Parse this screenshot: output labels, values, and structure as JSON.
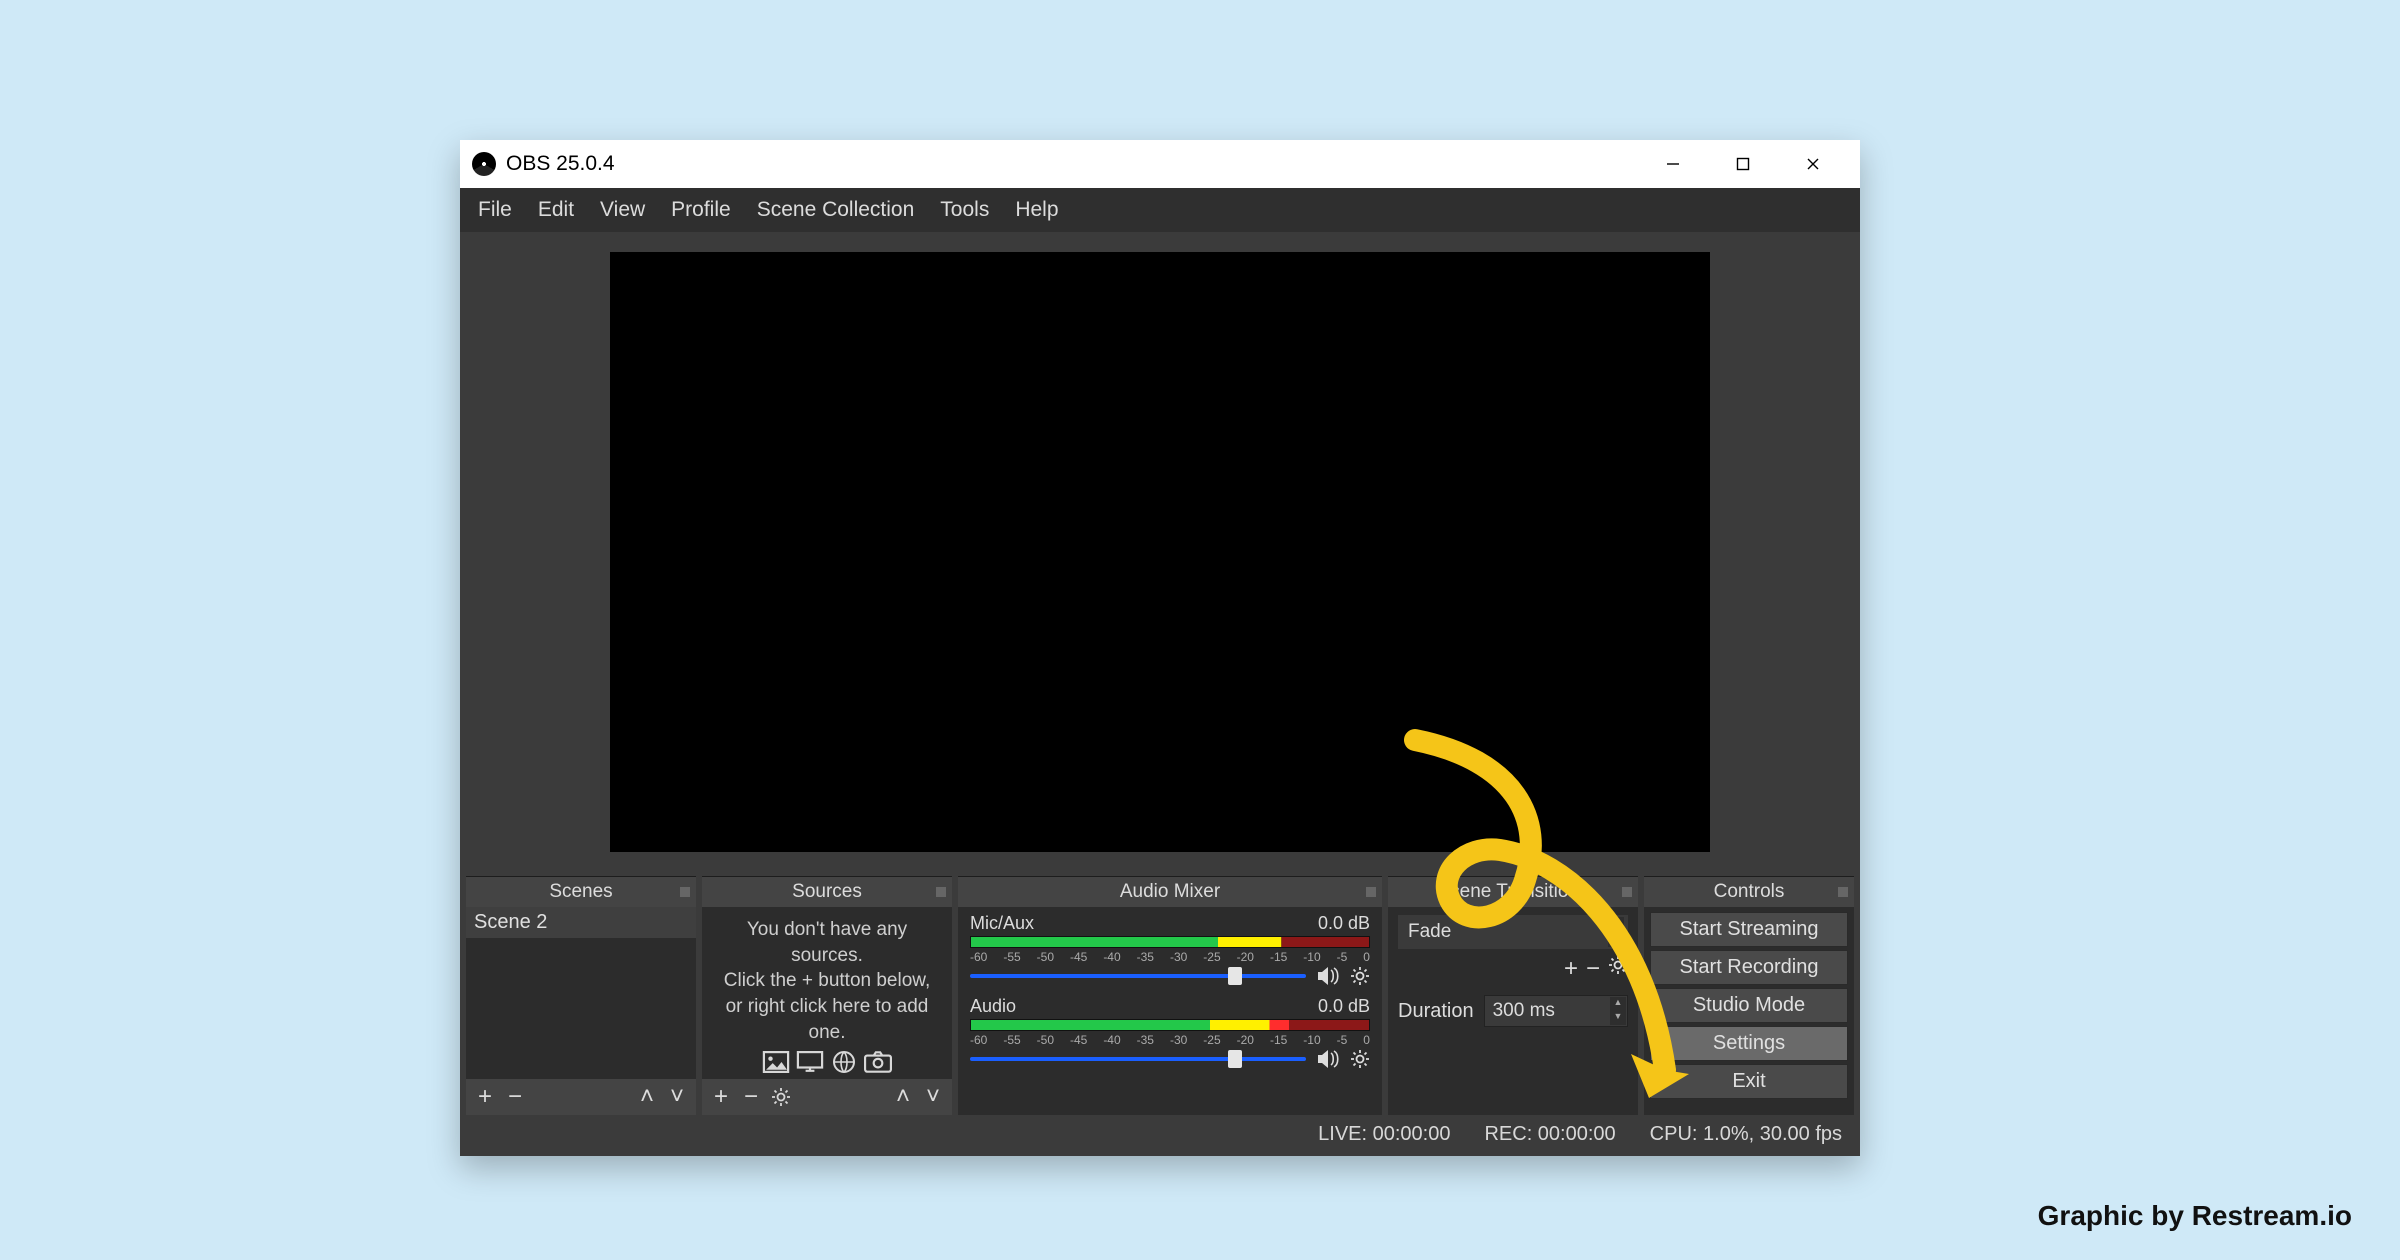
{
  "credit": "Graphic by Restream.io",
  "titlebar": {
    "title": "OBS 25.0.4"
  },
  "menu": {
    "file": "File",
    "edit": "Edit",
    "view": "View",
    "profile": "Profile",
    "scene_collection": "Scene Collection",
    "tools": "Tools",
    "help": "Help"
  },
  "docks": {
    "scenes": {
      "title": "Scenes",
      "selected": "Scene 2"
    },
    "sources": {
      "title": "Sources",
      "empty_line1": "You don't have any sources.",
      "empty_line2": "Click the + button below,",
      "empty_line3": "or right click here to add one."
    },
    "mixer": {
      "title": "Audio Mixer",
      "ch1": {
        "name": "Mic/Aux",
        "db": "0.0 dB"
      },
      "ch2": {
        "name": "Audio",
        "db": "0.0 dB"
      },
      "ticks": [
        "-60",
        "-55",
        "-50",
        "-45",
        "-40",
        "-35",
        "-30",
        "-25",
        "-20",
        "-15",
        "-10",
        "-5",
        "0"
      ]
    },
    "transitions": {
      "title": "Scene Transitions",
      "selected": "Fade",
      "duration_label": "Duration",
      "duration_value": "300 ms"
    },
    "controls": {
      "title": "Controls",
      "start_streaming": "Start Streaming",
      "start_recording": "Start Recording",
      "studio_mode": "Studio Mode",
      "settings": "Settings",
      "exit": "Exit"
    }
  },
  "statusbar": {
    "live": "LIVE: 00:00:00",
    "rec": "REC: 00:00:00",
    "cpu": "CPU: 1.0%, 30.00 fps"
  }
}
